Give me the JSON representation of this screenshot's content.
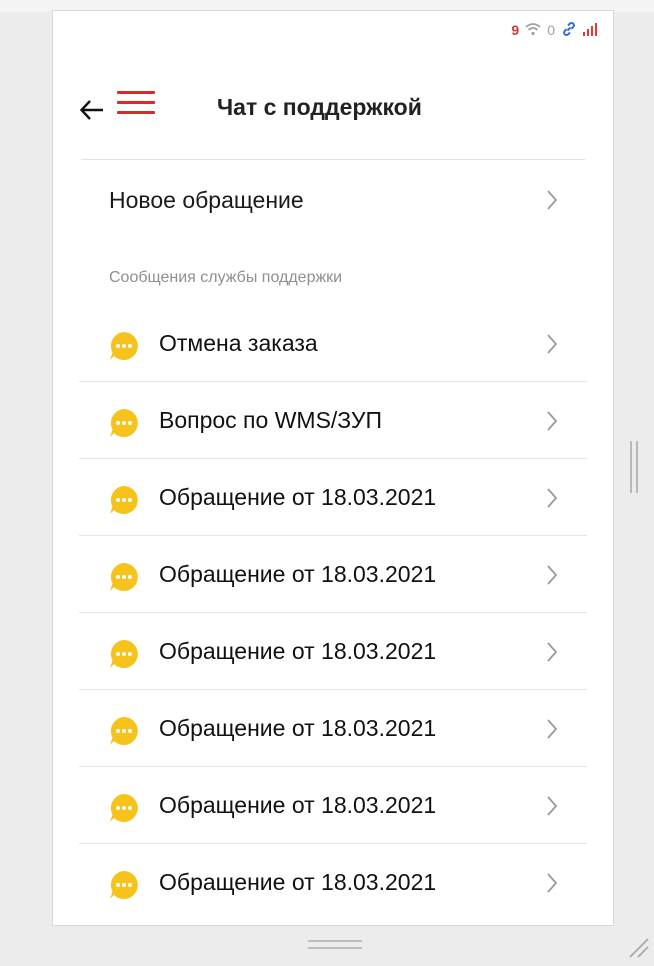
{
  "status_bar": {
    "number": "9",
    "wifi_icon": "wifi-icon",
    "zero": "0",
    "link_icon": "link-icon",
    "signal_icon": "signal-icon"
  },
  "header": {
    "title": "Чат с поддержкой",
    "back_icon": "arrow-left-icon",
    "menu_icon": "hamburger-menu-icon"
  },
  "new_request": {
    "label": "Новое обращение"
  },
  "section": {
    "label": "Сообщения службы поддержки"
  },
  "items": [
    {
      "label": "Отмена заказа"
    },
    {
      "label": "Вопрос по WMS/ЗУП"
    },
    {
      "label": "Обращение от 18.03.2021"
    },
    {
      "label": "Обращение от 18.03.2021"
    },
    {
      "label": "Обращение от 18.03.2021"
    },
    {
      "label": "Обращение от 18.03.2021"
    },
    {
      "label": "Обращение от 18.03.2021"
    },
    {
      "label": "Обращение от 18.03.2021"
    }
  ],
  "colors": {
    "accent_red": "#d62b2b",
    "bubble_yellow": "#f6c21c",
    "link_blue": "#2f6fd8"
  }
}
